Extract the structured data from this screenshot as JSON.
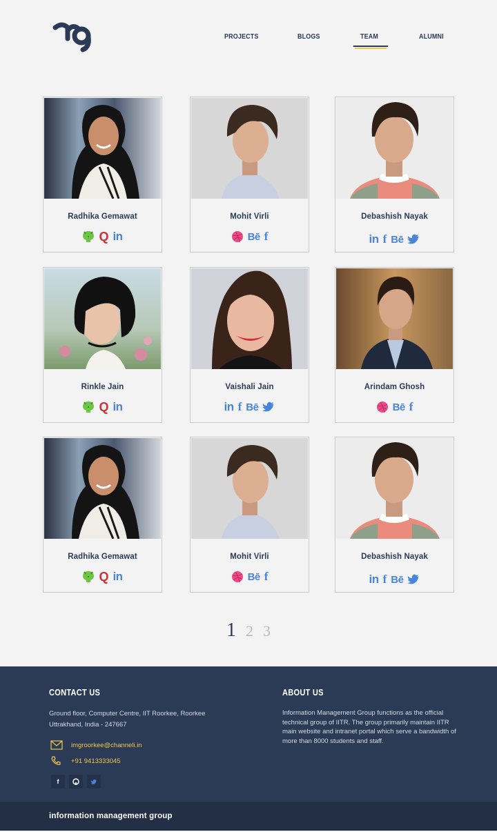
{
  "nav": {
    "items": [
      {
        "label": "PROJECTS"
      },
      {
        "label": "BLOGS"
      },
      {
        "label": "TEAM",
        "active": true
      },
      {
        "label": "ALUMNI"
      }
    ]
  },
  "team": [
    {
      "name": "Radhika Gemawat",
      "icons": [
        "github-icon",
        "quora-icon",
        "linkedin-icon"
      ]
    },
    {
      "name": "Mohit Virli",
      "icons": [
        "dribbble-icon",
        "behance-icon",
        "facebook-icon"
      ]
    },
    {
      "name": "Debashish Nayak",
      "icons": [
        "linkedin-icon",
        "facebook-icon",
        "behance-icon",
        "twitter-icon"
      ]
    },
    {
      "name": "Rinkle Jain",
      "icons": [
        "github-icon",
        "quora-icon",
        "linkedin-icon"
      ]
    },
    {
      "name": "Vaishali Jain",
      "icons": [
        "linkedin-icon",
        "facebook-icon",
        "behance-icon",
        "twitter-icon"
      ]
    },
    {
      "name": "Arindam Ghosh",
      "icons": [
        "dribbble-icon",
        "behance-icon",
        "facebook-icon"
      ]
    },
    {
      "name": "Radhika Gemawat",
      "icons": [
        "github-icon",
        "quora-icon",
        "linkedin-icon"
      ]
    },
    {
      "name": "Mohit Virli",
      "icons": [
        "dribbble-icon",
        "behance-icon",
        "facebook-icon"
      ]
    },
    {
      "name": "Debashish Nayak",
      "icons": [
        "linkedin-icon",
        "facebook-icon",
        "behance-icon",
        "twitter-icon"
      ]
    }
  ],
  "icon_glyphs": {
    "linkedin": "in",
    "facebook": "f",
    "behance": "Bē",
    "quora": "Q"
  },
  "pagination": {
    "pages": [
      "1",
      "2",
      "3"
    ],
    "current": "1"
  },
  "footer": {
    "contact_title": "CONTACT US",
    "address_line1": "Ground floor, Computer Centre, IIT Roorkee, Roorkee",
    "address_line2": "Uttrakhand, India - 247667",
    "email": "imgroorkee@channeli.in",
    "phone": "+91 9413333045",
    "social": [
      "f",
      "gh",
      "tw"
    ],
    "about_title": "ABOUT US",
    "about_text": "Information Management Group functions as the official technical group of IITR. The group primarily maintain IITR main website and intranet portal which serve a bandwidth of more than 8000 students and staff."
  },
  "bottom_bar": {
    "text": "information management group"
  },
  "colors": {
    "navy": "#2b3a55",
    "accent_yellow": "#f2c94c",
    "link_blue": "#4a86d8",
    "quora_red": "#c8323a",
    "dribbble_pink": "#ea4c89",
    "github_green": "#6cc644"
  }
}
